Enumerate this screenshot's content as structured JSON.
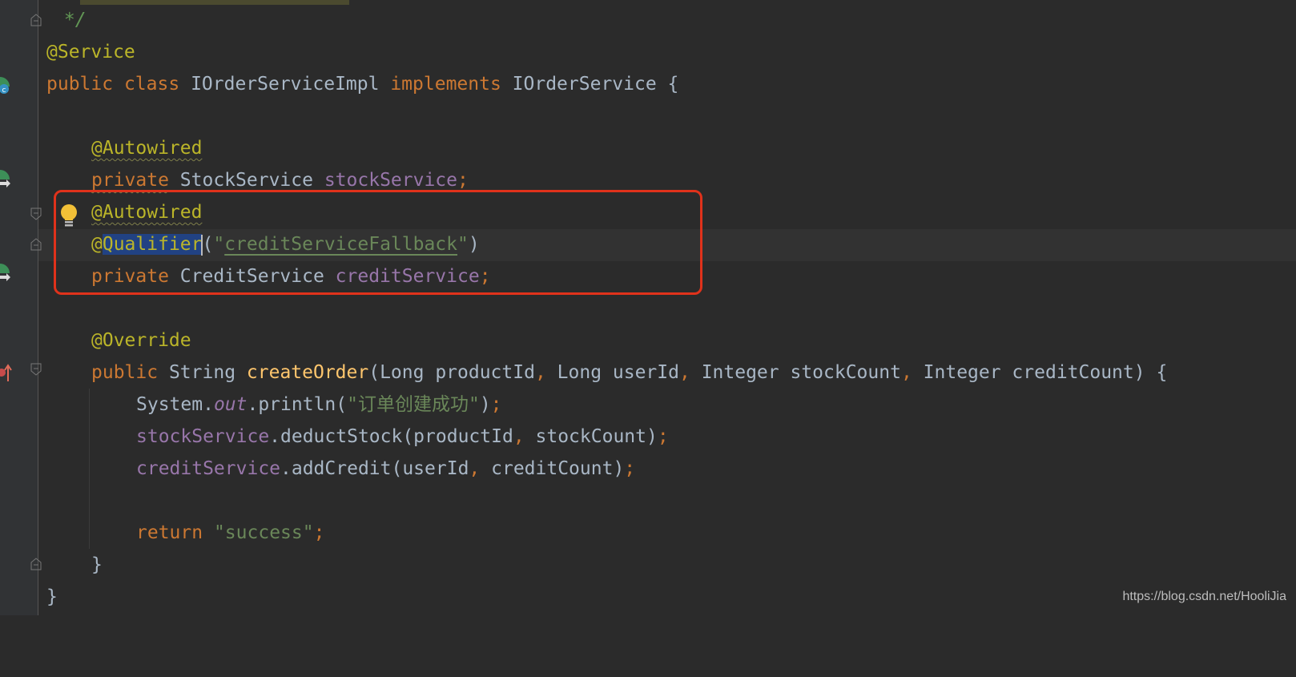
{
  "editor": {
    "lines": {
      "l0": {
        "comment_end": " */"
      },
      "l1": {
        "annotation": "@Service"
      },
      "l2": {
        "kw_public": "public",
        "kw_class": "class",
        "class_name": "IOrderServiceImpl",
        "kw_implements": "implements",
        "interface_name": "IOrderService",
        "brace": "{"
      },
      "l4": {
        "annotation": "@Autowired"
      },
      "l5": {
        "kw_private": "private",
        "type": "StockService",
        "field": "stockService",
        "semi": ";"
      },
      "l6": {
        "annotation": "@Autowired"
      },
      "l7": {
        "at": "@",
        "name_selected": "Qualifier",
        "open_paren": "(",
        "quote_open": "\"",
        "value": "creditServiceFallback",
        "quote_close": "\"",
        "close_paren": ")"
      },
      "l8": {
        "kw_private": "private",
        "type": "CreditService",
        "field": "creditService",
        "semi": ";"
      },
      "l10": {
        "annotation": "@Override"
      },
      "l11": {
        "kw_public": "public",
        "return_type": "String",
        "method": "createOrder",
        "params_1": "(Long productId",
        "c1": ",",
        "params_2": " Long userId",
        "c2": ",",
        "params_3": " Integer stockCount",
        "c3": ",",
        "params_4": " Integer creditCount) {"
      },
      "l12": {
        "system": "System.",
        "out": "out",
        "println": ".println(",
        "string": "\"订单创建成功\"",
        "end_paren": ")",
        "semi": ";"
      },
      "l13": {
        "field": "stockService",
        "call": ".deductStock(productId",
        "comma": ",",
        "args": " stockCount)",
        "semi": ";"
      },
      "l14": {
        "field": "creditService",
        "call": ".addCredit(userId",
        "comma": ",",
        "args": " creditCount)",
        "semi": ";"
      },
      "l16": {
        "kw_return": "return",
        "string": "\"success\"",
        "semi": ";"
      },
      "l17": {
        "brace": "}"
      },
      "l18": {
        "brace": "}"
      }
    }
  },
  "gutter_icons": [
    "spring-bean-icon",
    "autowired-nav-icon",
    "autowired-nav-icon",
    "override-icon"
  ],
  "watermark": "https://blog.csdn.net/HooliJia",
  "colors": {
    "background": "#2b2b2b",
    "keyword": "#cc7832",
    "annotation": "#bbb529",
    "string": "#6a8759",
    "field": "#9876aa",
    "method": "#ffc66d",
    "highlight_box": "#e0321b",
    "selection": "#214283"
  }
}
